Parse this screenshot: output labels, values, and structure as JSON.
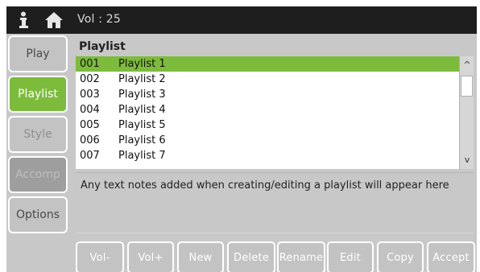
{
  "topbar": {
    "volume_text": "Vol : 25",
    "icons": [
      "info-icon",
      "home-icon"
    ]
  },
  "sidebar": {
    "items": [
      {
        "label": "Play",
        "state": "normal"
      },
      {
        "label": "Playlist",
        "state": "active"
      },
      {
        "label": "Style",
        "state": "dim"
      },
      {
        "label": "Accomp",
        "state": "disabled"
      },
      {
        "label": "Options",
        "state": "normal"
      }
    ]
  },
  "panel": {
    "title": "Playlist",
    "rows": [
      {
        "num": "001",
        "name": "Playlist 1",
        "selected": true
      },
      {
        "num": "002",
        "name": "Playlist 2"
      },
      {
        "num": "003",
        "name": "Playlist 3"
      },
      {
        "num": "004",
        "name": "Playlist 4"
      },
      {
        "num": "005",
        "name": "Playlist 5"
      },
      {
        "num": "006",
        "name": "Playlist 6"
      },
      {
        "num": "007",
        "name": "Playlist 7"
      }
    ],
    "scroll_up": "^",
    "scroll_down": "v",
    "notes": "Any text notes added when creating/editing a playlist will appear here"
  },
  "buttons": {
    "vol_down": "Vol-",
    "vol_up": "Vol+",
    "new": "New",
    "delete": "Delete",
    "rename": "Rename",
    "edit": "Edit",
    "copy": "Copy",
    "accept": "Accept"
  },
  "colors": {
    "accent_green": "#7dbb3d",
    "topbar": "#1e1e1e",
    "panel_gray": "#c8c8c8"
  }
}
